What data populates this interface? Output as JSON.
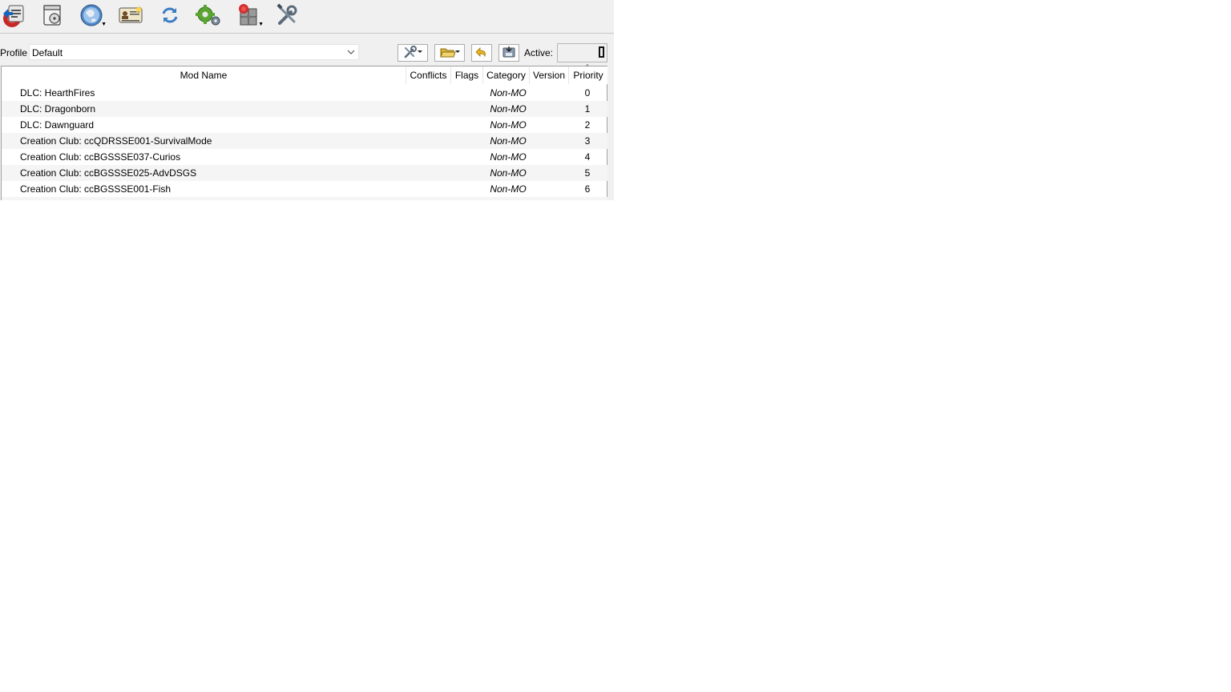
{
  "toolbar": {
    "buttons": [
      {
        "name": "install-mod-icon"
      },
      {
        "name": "nexus-disc-icon"
      },
      {
        "name": "globe-icon",
        "has_dropdown": true
      },
      {
        "name": "profiles-icon"
      },
      {
        "name": "refresh-icon"
      },
      {
        "name": "executables-gears-icon"
      },
      {
        "name": "tools-puzzle-icon",
        "has_dropdown": true
      },
      {
        "name": "settings-wrench-icon"
      }
    ]
  },
  "profile": {
    "label": "Profile",
    "selected": "Default"
  },
  "actions": {
    "active_label": "Active:",
    "active_value": ""
  },
  "table": {
    "columns": [
      "Mod Name",
      "Conflicts",
      "Flags",
      "Category",
      "Version",
      "Priority"
    ],
    "rows": [
      {
        "name": "DLC: HearthFires",
        "conflicts": "",
        "flags": "",
        "category": "Non-MO",
        "version": "",
        "priority": "0"
      },
      {
        "name": "DLC: Dragonborn",
        "conflicts": "",
        "flags": "",
        "category": "Non-MO",
        "version": "",
        "priority": "1"
      },
      {
        "name": "DLC: Dawnguard",
        "conflicts": "",
        "flags": "",
        "category": "Non-MO",
        "version": "",
        "priority": "2"
      },
      {
        "name": "Creation Club: ccQDRSSE001-SurvivalMode",
        "conflicts": "",
        "flags": "",
        "category": "Non-MO",
        "version": "",
        "priority": "3"
      },
      {
        "name": "Creation Club: ccBGSSSE037-Curios",
        "conflicts": "",
        "flags": "",
        "category": "Non-MO",
        "version": "",
        "priority": "4"
      },
      {
        "name": "Creation Club: ccBGSSSE025-AdvDSGS",
        "conflicts": "",
        "flags": "",
        "category": "Non-MO",
        "version": "",
        "priority": "5"
      },
      {
        "name": "Creation Club: ccBGSSSE001-Fish",
        "conflicts": "",
        "flags": "",
        "category": "Non-MO",
        "version": "",
        "priority": "6"
      }
    ]
  },
  "colors": {
    "window_bg": "#f0f0f0",
    "row_alt": "#f5f5f5",
    "border": "#a0a0a0"
  }
}
